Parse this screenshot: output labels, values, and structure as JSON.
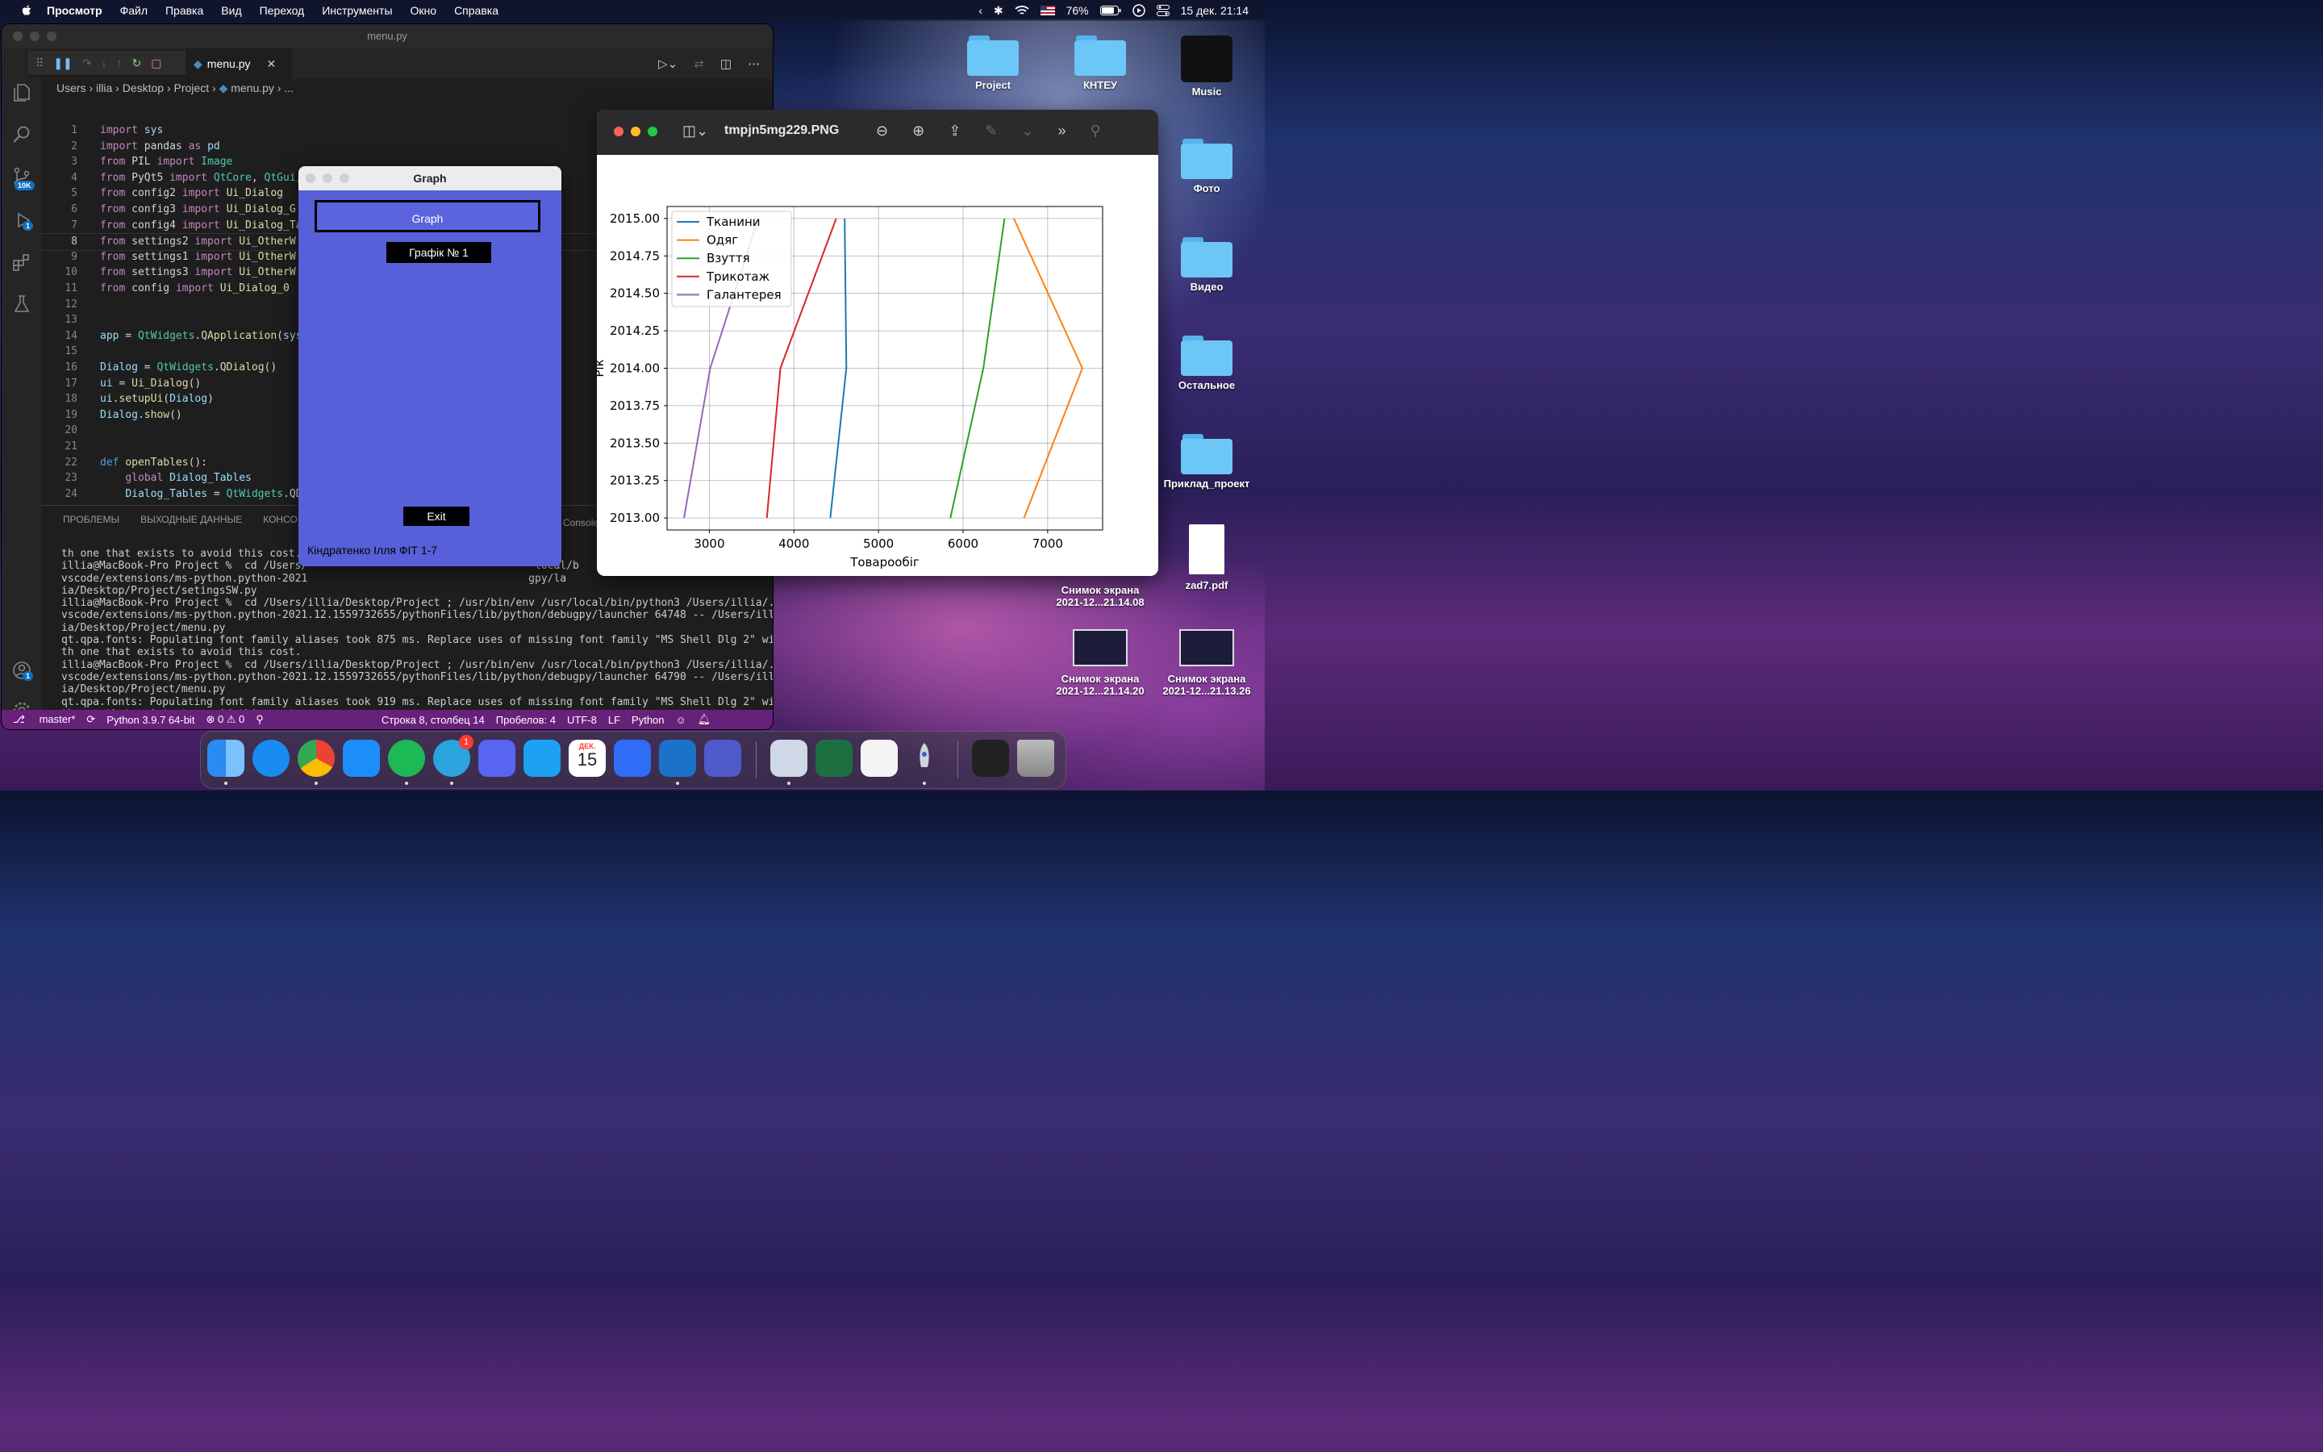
{
  "menubar": {
    "items": [
      "Просмотр",
      "Файл",
      "Правка",
      "Вид",
      "Переход",
      "Инструменты",
      "Окно",
      "Справка"
    ],
    "battery": "76%",
    "datetime": "15 дек.  21:14"
  },
  "vscode": {
    "window_title": "menu.py",
    "tab_label": "menu.py",
    "breadcrumb": [
      "Users",
      "illia",
      "Desktop",
      "Project",
      "menu.py",
      "..."
    ],
    "badges": {
      "source_control": "10K",
      "run_debug": "1",
      "accounts": "1"
    },
    "code_lines": [
      {
        "n": "1",
        "text": "import sys"
      },
      {
        "n": "2",
        "text": "import pandas as pd"
      },
      {
        "n": "3",
        "text": "from PIL import Image"
      },
      {
        "n": "4",
        "text": "from PyQt5 import QtCore, QtGui, QtWidgets"
      },
      {
        "n": "5",
        "text": "from config2 import Ui_Dialog"
      },
      {
        "n": "6",
        "text": "from config3 import Ui_Dialog_G"
      },
      {
        "n": "7",
        "text": "from config4 import Ui_Dialog_Ta"
      },
      {
        "n": "8",
        "text": "from settings2 import Ui_OtherW"
      },
      {
        "n": "9",
        "text": "from settings1 import Ui_OtherW"
      },
      {
        "n": "10",
        "text": "from settings3 import Ui_OtherW"
      },
      {
        "n": "11",
        "text": "from config import Ui_Dialog_0"
      },
      {
        "n": "12",
        "text": ""
      },
      {
        "n": "13",
        "text": ""
      },
      {
        "n": "14",
        "text": "app = QtWidgets.QApplication(sys"
      },
      {
        "n": "15",
        "text": ""
      },
      {
        "n": "16",
        "text": "Dialog = QtWidgets.QDialog()"
      },
      {
        "n": "17",
        "text": "ui = Ui_Dialog()"
      },
      {
        "n": "18",
        "text": "ui.setupUi(Dialog)"
      },
      {
        "n": "19",
        "text": "Dialog.show()"
      },
      {
        "n": "20",
        "text": ""
      },
      {
        "n": "21",
        "text": ""
      },
      {
        "n": "22",
        "text": "def openTables():"
      },
      {
        "n": "23",
        "text": "    global Dialog_Tables"
      },
      {
        "n": "24",
        "text": "    Dialog_Tables = QtWidgets.QD"
      }
    ],
    "panel_tabs": [
      "ПРОБЛЕМЫ",
      "ВЫХОДНЫЕ ДАННЫЕ",
      "КОНСО",
      "Console"
    ],
    "terminal_lines": [
      "th one that exists to avoid this cost.",
      "illia@MacBook-Pro Project %  cd /Users/                                    local/b",
      "vscode/extensions/ms-python.python-2021                                   gpy/la",
      "ia/Desktop/Project/setingsSW.py",
      "illia@MacBook-Pro Project %  cd /Users/illia/Desktop/Project ; /usr/bin/env /usr/local/bin/python3 /Users/illia/.",
      "vscode/extensions/ms-python.python-2021.12.1559732655/pythonFiles/lib/python/debugpy/launcher 64748 -- /Users/ill",
      "ia/Desktop/Project/menu.py",
      "qt.qpa.fonts: Populating font family aliases took 875 ms. Replace uses of missing font family \"MS Shell Dlg 2\" wi",
      "th one that exists to avoid this cost.",
      "illia@MacBook-Pro Project %  cd /Users/illia/Desktop/Project ; /usr/bin/env /usr/local/bin/python3 /Users/illia/.",
      "vscode/extensions/ms-python.python-2021.12.1559732655/pythonFiles/lib/python/debugpy/launcher 64790 -- /Users/ill",
      "ia/Desktop/Project/menu.py",
      "qt.qpa.fonts: Populating font family aliases took 919 ms. Replace uses of missing font family \"MS Shell Dlg 2\" wi",
      "th one that exists to avoid this cost."
    ],
    "status": {
      "branch": "master*",
      "python": "Python 3.9.7 64-bit",
      "problems": "⊗ 0 ⚠ 0",
      "position": "Строка 8, столбец 14",
      "spaces": "Пробелов: 4",
      "encoding": "UTF-8",
      "eol": "LF",
      "language": "Python"
    }
  },
  "qt_dialog": {
    "title": "Graph",
    "header": "Graph",
    "graph_button": "Графік № 1",
    "exit_button": "Exit",
    "author": "Кіндратенко Ілля ФІТ 1-7"
  },
  "preview": {
    "filename": "tmpjn5mg229.PNG"
  },
  "chart_data": {
    "type": "line",
    "xlabel": "Товарообіг",
    "ylabel": "Рік",
    "xlim": [
      2500,
      7650
    ],
    "ylim": [
      2012.92,
      2015.08
    ],
    "xticks": [
      "3000",
      "4000",
      "5000",
      "6000",
      "7000"
    ],
    "yticks": [
      "2013.00",
      "2013.25",
      "2013.50",
      "2013.75",
      "2014.00",
      "2014.25",
      "2014.50",
      "2014.75",
      "2015.00"
    ],
    "grid": true,
    "legend_position": "upper-left",
    "series": [
      {
        "name": "Тканини",
        "color": "#1f77b4",
        "points": [
          [
            4430,
            2013
          ],
          [
            4620,
            2014
          ],
          [
            4600,
            2015
          ]
        ]
      },
      {
        "name": "Одяг",
        "color": "#ff7f0e",
        "points": [
          [
            6720,
            2013
          ],
          [
            7410,
            2014
          ],
          [
            6600,
            2015
          ]
        ]
      },
      {
        "name": "Взуття",
        "color": "#2ca02c",
        "points": [
          [
            5850,
            2013
          ],
          [
            6240,
            2014
          ],
          [
            6490,
            2015
          ]
        ]
      },
      {
        "name": "Трикотаж",
        "color": "#d62728",
        "points": [
          [
            3680,
            2013
          ],
          [
            3840,
            2014
          ],
          [
            4500,
            2015
          ]
        ]
      },
      {
        "name": "Галантерея",
        "color": "#9467bd",
        "points": [
          [
            2700,
            2013
          ],
          [
            3010,
            2014
          ],
          [
            3580,
            2015
          ]
        ]
      }
    ]
  },
  "desktop": {
    "icons": [
      "Project",
      "КНТЕУ",
      "Music",
      "Фото",
      "Видео",
      "Остальное",
      "Приклад_проект",
      "zad7.pdf"
    ],
    "screenshot_1": [
      "Снимок экрана",
      "2021-12...21.14.08"
    ],
    "screenshot_2": [
      "Снимок экрана",
      "2021-12...21.14.20"
    ],
    "screenshot_3": [
      "Снимок экрана",
      "2021-12...21.13.26"
    ]
  },
  "dock": {
    "telegram_badge": "1",
    "calendar_month": "ДЕК.",
    "calendar_day": "15",
    "apps": [
      "Finder",
      "Safari",
      "Chrome",
      "App Store",
      "Spotify",
      "Telegram",
      "Discord",
      "Twitter",
      "Calendar",
      "Spark",
      "VS Code",
      "Teams",
      "Preview",
      "Excel",
      "TextEdit",
      "Rocket",
      "Screenshots",
      "Trash"
    ]
  }
}
